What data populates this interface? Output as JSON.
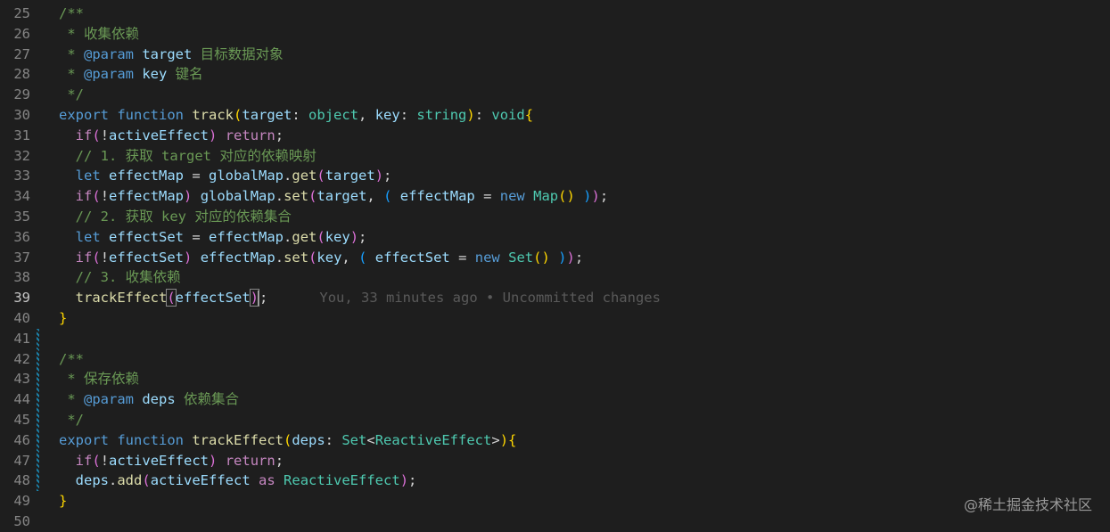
{
  "editor": {
    "active_line": "39",
    "lines": [
      {
        "n": "25",
        "tokens": [
          [
            "c-comment",
            "/**"
          ]
        ]
      },
      {
        "n": "26",
        "tokens": [
          [
            "c-comment",
            " * 收集依赖"
          ]
        ]
      },
      {
        "n": "27",
        "tokens": [
          [
            "c-comment",
            " * "
          ],
          [
            "c-kw",
            "@param"
          ],
          [
            "c-var",
            " target"
          ],
          [
            "c-comment",
            " 目标数据对象"
          ]
        ]
      },
      {
        "n": "28",
        "tokens": [
          [
            "c-comment",
            " * "
          ],
          [
            "c-kw",
            "@param"
          ],
          [
            "c-var",
            " key"
          ],
          [
            "c-comment",
            " 键名"
          ]
        ]
      },
      {
        "n": "29",
        "tokens": [
          [
            "c-comment",
            " */"
          ]
        ]
      },
      {
        "n": "30",
        "tokens": [
          [
            "c-kw",
            "export"
          ],
          [
            "c-plain",
            " "
          ],
          [
            "c-kw",
            "function"
          ],
          [
            "c-plain",
            " "
          ],
          [
            "c-fn",
            "track"
          ],
          [
            "c-b1",
            "("
          ],
          [
            "c-var",
            "target"
          ],
          [
            "c-plain",
            ": "
          ],
          [
            "c-type",
            "object"
          ],
          [
            "c-plain",
            ", "
          ],
          [
            "c-var",
            "key"
          ],
          [
            "c-plain",
            ": "
          ],
          [
            "c-type",
            "string"
          ],
          [
            "c-b1",
            ")"
          ],
          [
            "c-plain",
            ": "
          ],
          [
            "c-type",
            "void"
          ],
          [
            "c-b1",
            "{"
          ]
        ]
      },
      {
        "n": "31",
        "tokens": [
          [
            "c-plain",
            "  "
          ],
          [
            "c-ctrl",
            "if"
          ],
          [
            "c-b2",
            "("
          ],
          [
            "c-plain",
            "!"
          ],
          [
            "c-var",
            "activeEffect"
          ],
          [
            "c-b2",
            ")"
          ],
          [
            "c-plain",
            " "
          ],
          [
            "c-ctrl",
            "return"
          ],
          [
            "c-plain",
            ";"
          ]
        ]
      },
      {
        "n": "32",
        "tokens": [
          [
            "c-plain",
            "  "
          ],
          [
            "c-comment",
            "// 1. 获取 target 对应的依赖映射"
          ]
        ]
      },
      {
        "n": "33",
        "tokens": [
          [
            "c-plain",
            "  "
          ],
          [
            "c-kw",
            "let"
          ],
          [
            "c-plain",
            " "
          ],
          [
            "c-var",
            "effectMap"
          ],
          [
            "c-plain",
            " = "
          ],
          [
            "c-var",
            "globalMap"
          ],
          [
            "c-plain",
            "."
          ],
          [
            "c-fn",
            "get"
          ],
          [
            "c-b2",
            "("
          ],
          [
            "c-var",
            "target"
          ],
          [
            "c-b2",
            ")"
          ],
          [
            "c-plain",
            ";"
          ]
        ]
      },
      {
        "n": "34",
        "tokens": [
          [
            "c-plain",
            "  "
          ],
          [
            "c-ctrl",
            "if"
          ],
          [
            "c-b2",
            "("
          ],
          [
            "c-plain",
            "!"
          ],
          [
            "c-var",
            "effectMap"
          ],
          [
            "c-b2",
            ")"
          ],
          [
            "c-plain",
            " "
          ],
          [
            "c-var",
            "globalMap"
          ],
          [
            "c-plain",
            "."
          ],
          [
            "c-fn",
            "set"
          ],
          [
            "c-b2",
            "("
          ],
          [
            "c-var",
            "target"
          ],
          [
            "c-plain",
            ", "
          ],
          [
            "c-b3",
            "("
          ],
          [
            "c-plain",
            " "
          ],
          [
            "c-var",
            "effectMap"
          ],
          [
            "c-plain",
            " = "
          ],
          [
            "c-kw",
            "new"
          ],
          [
            "c-plain",
            " "
          ],
          [
            "c-type",
            "Map"
          ],
          [
            "c-b1",
            "()"
          ],
          [
            "c-plain",
            " "
          ],
          [
            "c-b3",
            ")"
          ],
          [
            "c-b2",
            ")"
          ],
          [
            "c-plain",
            ";"
          ]
        ]
      },
      {
        "n": "35",
        "tokens": [
          [
            "c-plain",
            "  "
          ],
          [
            "c-comment",
            "// 2. 获取 key 对应的依赖集合"
          ]
        ]
      },
      {
        "n": "36",
        "tokens": [
          [
            "c-plain",
            "  "
          ],
          [
            "c-kw",
            "let"
          ],
          [
            "c-plain",
            " "
          ],
          [
            "c-var",
            "effectSet"
          ],
          [
            "c-plain",
            " = "
          ],
          [
            "c-var",
            "effectMap"
          ],
          [
            "c-plain",
            "."
          ],
          [
            "c-fn",
            "get"
          ],
          [
            "c-b2",
            "("
          ],
          [
            "c-var",
            "key"
          ],
          [
            "c-b2",
            ")"
          ],
          [
            "c-plain",
            ";"
          ]
        ]
      },
      {
        "n": "37",
        "tokens": [
          [
            "c-plain",
            "  "
          ],
          [
            "c-ctrl",
            "if"
          ],
          [
            "c-b2",
            "("
          ],
          [
            "c-plain",
            "!"
          ],
          [
            "c-var",
            "effectSet"
          ],
          [
            "c-b2",
            ")"
          ],
          [
            "c-plain",
            " "
          ],
          [
            "c-var",
            "effectMap"
          ],
          [
            "c-plain",
            "."
          ],
          [
            "c-fn",
            "set"
          ],
          [
            "c-b2",
            "("
          ],
          [
            "c-var",
            "key"
          ],
          [
            "c-plain",
            ", "
          ],
          [
            "c-b3",
            "("
          ],
          [
            "c-plain",
            " "
          ],
          [
            "c-var",
            "effectSet"
          ],
          [
            "c-plain",
            " = "
          ],
          [
            "c-kw",
            "new"
          ],
          [
            "c-plain",
            " "
          ],
          [
            "c-type",
            "Set"
          ],
          [
            "c-b1",
            "()"
          ],
          [
            "c-plain",
            " "
          ],
          [
            "c-b3",
            ")"
          ],
          [
            "c-b2",
            ")"
          ],
          [
            "c-plain",
            ";"
          ]
        ]
      },
      {
        "n": "38",
        "tokens": [
          [
            "c-plain",
            "  "
          ],
          [
            "c-comment",
            "// 3. 收集依赖"
          ]
        ]
      },
      {
        "n": "39",
        "tokens": [
          [
            "c-plain",
            "  "
          ],
          [
            "c-fn",
            "trackEffect"
          ],
          [
            "c-b2 bracket-hl",
            "("
          ],
          [
            "c-var",
            "effectSet"
          ],
          [
            "c-b2 bracket-hl",
            ")"
          ],
          [
            "cursor",
            ""
          ],
          [
            "c-plain",
            ";"
          ]
        ],
        "blame": "You, 33 minutes ago • Uncommitted changes"
      },
      {
        "n": "40",
        "tokens": [
          [
            "c-b1",
            "}"
          ]
        ]
      },
      {
        "n": "41",
        "tokens": [],
        "mark": true
      },
      {
        "n": "42",
        "tokens": [
          [
            "c-comment",
            "/**"
          ]
        ],
        "mark": true
      },
      {
        "n": "43",
        "tokens": [
          [
            "c-comment",
            " * 保存依赖"
          ]
        ],
        "mark": true
      },
      {
        "n": "44",
        "tokens": [
          [
            "c-comment",
            " * "
          ],
          [
            "c-kw",
            "@param"
          ],
          [
            "c-var",
            " deps"
          ],
          [
            "c-comment",
            " 依赖集合"
          ]
        ],
        "mark": true
      },
      {
        "n": "45",
        "tokens": [
          [
            "c-comment",
            " */"
          ]
        ],
        "mark": true
      },
      {
        "n": "46",
        "tokens": [
          [
            "c-kw",
            "export"
          ],
          [
            "c-plain",
            " "
          ],
          [
            "c-kw",
            "function"
          ],
          [
            "c-plain",
            " "
          ],
          [
            "c-fn",
            "trackEffect"
          ],
          [
            "c-b1",
            "("
          ],
          [
            "c-var",
            "deps"
          ],
          [
            "c-plain",
            ": "
          ],
          [
            "c-type",
            "Set"
          ],
          [
            "c-plain",
            "<"
          ],
          [
            "c-type",
            "ReactiveEffect"
          ],
          [
            "c-plain",
            ">"
          ],
          [
            "c-b1",
            ")"
          ],
          [
            "c-b1",
            "{"
          ]
        ],
        "mark": true
      },
      {
        "n": "47",
        "tokens": [
          [
            "c-plain",
            "  "
          ],
          [
            "c-ctrl",
            "if"
          ],
          [
            "c-b2",
            "("
          ],
          [
            "c-plain",
            "!"
          ],
          [
            "c-var",
            "activeEffect"
          ],
          [
            "c-b2",
            ")"
          ],
          [
            "c-plain",
            " "
          ],
          [
            "c-ctrl",
            "return"
          ],
          [
            "c-plain",
            ";"
          ]
        ],
        "mark": true
      },
      {
        "n": "48",
        "tokens": [
          [
            "c-plain",
            "  "
          ],
          [
            "c-var",
            "deps"
          ],
          [
            "c-plain",
            "."
          ],
          [
            "c-fn",
            "add"
          ],
          [
            "c-b2",
            "("
          ],
          [
            "c-var",
            "activeEffect"
          ],
          [
            "c-plain",
            " "
          ],
          [
            "c-ctrl",
            "as"
          ],
          [
            "c-plain",
            " "
          ],
          [
            "c-type",
            "ReactiveEffect"
          ],
          [
            "c-b2",
            ")"
          ],
          [
            "c-plain",
            ";"
          ]
        ],
        "mark": true
      },
      {
        "n": "49",
        "tokens": [
          [
            "c-b1",
            "}"
          ]
        ]
      },
      {
        "n": "50",
        "tokens": []
      }
    ]
  },
  "watermark": "@稀土掘金技术社区"
}
